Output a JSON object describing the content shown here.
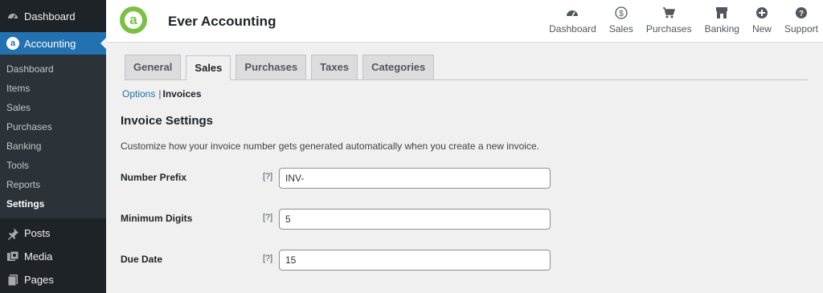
{
  "sidebar": {
    "dashboard": "Dashboard",
    "accounting": "Accounting",
    "submenu": [
      "Dashboard",
      "Items",
      "Sales",
      "Purchases",
      "Banking",
      "Tools",
      "Reports",
      "Settings"
    ],
    "posts": "Posts",
    "media": "Media",
    "pages": "Pages"
  },
  "header": {
    "brand": "Ever Accounting",
    "nav": [
      "Dashboard",
      "Sales",
      "Purchases",
      "Banking",
      "New",
      "Support"
    ]
  },
  "tabs": [
    "General",
    "Sales",
    "Purchases",
    "Taxes",
    "Categories"
  ],
  "subnav": {
    "options": "Options",
    "separator": "|",
    "invoices": "Invoices"
  },
  "section": {
    "title": "Invoice Settings",
    "description": "Customize how your invoice number gets generated automatically when you create a new invoice."
  },
  "fields": [
    {
      "label": "Number Prefix",
      "help": "[?]",
      "value": "INV-"
    },
    {
      "label": "Minimum Digits",
      "help": "[?]",
      "value": "5"
    },
    {
      "label": "Due Date",
      "help": "[?]",
      "value": "15"
    }
  ],
  "colors": {
    "accent": "#2271b1",
    "brand": "#7ac142",
    "sidebar": "#1d2327"
  }
}
